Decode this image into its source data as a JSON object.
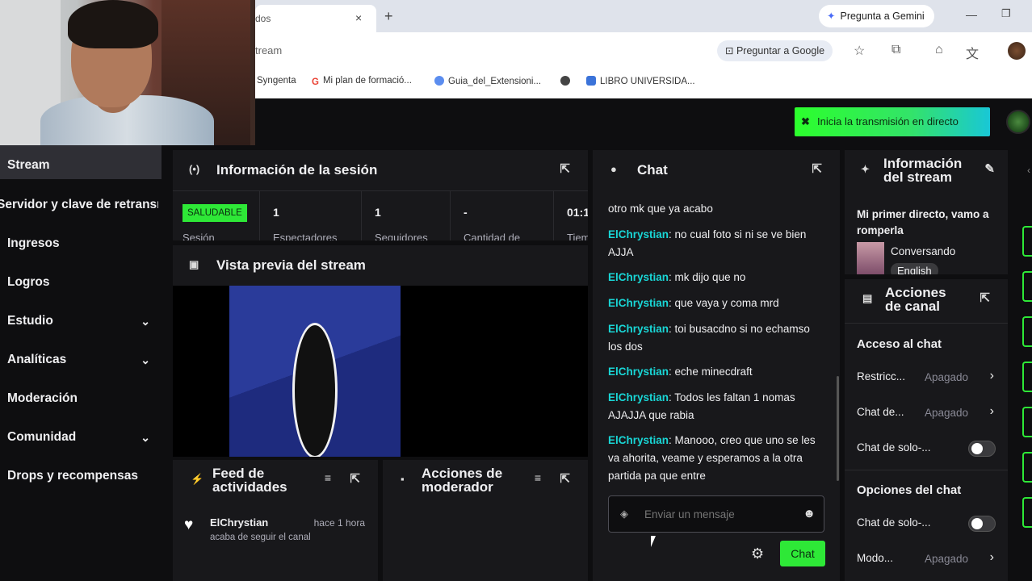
{
  "browser": {
    "tab_title": "dos",
    "tab_close": "×",
    "new_tab": "+",
    "gemini_button": "Pregunta a Gemini",
    "url": "tream",
    "ask_google": "Preguntar a Google",
    "bookmarks": [
      {
        "label": "Syngenta",
        "icon_color": "#1e88e5"
      },
      {
        "label": "Mi plan de formació...",
        "icon_color": "#ea4335"
      },
      {
        "label": "Guia_del_Extensioni...",
        "icon_color": "#5b8def"
      },
      {
        "label": "",
        "icon_color": "#444444"
      },
      {
        "label": "LIBRO UNIVERSIDA...",
        "icon_color": "#3b73d9"
      }
    ]
  },
  "topbar": {
    "go_live": "Inicia la transmisión en directo",
    "accent": "#2ee837"
  },
  "sidebar": {
    "items": [
      {
        "label": "Stream"
      },
      {
        "label": "Servidor y clave de retransmisión"
      },
      {
        "label": "Ingresos"
      },
      {
        "label": "Logros"
      },
      {
        "label": "Estudio",
        "chevron": "⌄"
      },
      {
        "label": "Analíticas",
        "chevron": "⌄"
      },
      {
        "label": "Moderación"
      },
      {
        "label": "Comunidad",
        "chevron": "⌄"
      },
      {
        "label": "Drops y recompensas"
      }
    ]
  },
  "session": {
    "title": "Información de la sesión",
    "badge": "SALUDABLE",
    "badge_sub": "Sesión",
    "stats": [
      {
        "value": "1",
        "label": "Espectadores"
      },
      {
        "value": "1",
        "label": "Seguidores"
      },
      {
        "value": "-",
        "label": "Cantidad de"
      },
      {
        "value": "01:1",
        "label": "Tiem"
      }
    ]
  },
  "preview": {
    "title": "Vista previa del stream"
  },
  "feed": {
    "title_line1": "Feed de",
    "title_line2": "actividades",
    "item": {
      "user": "ElChrystian",
      "time": "hace 1 hora",
      "action": "acaba de seguir el canal"
    }
  },
  "modactions": {
    "title_line1": "Acciones de",
    "title_line2": "moderador"
  },
  "chat": {
    "title": "Chat",
    "messages": [
      {
        "user": "",
        "text": "otro mk que ya acabo"
      },
      {
        "user": "ElChrystian",
        "text": "no cual foto si ni se ve bien AJJA"
      },
      {
        "user": "ElChrystian",
        "text": "mk dijo que no"
      },
      {
        "user": "ElChrystian",
        "text": "que vaya y coma mrd"
      },
      {
        "user": "ElChrystian",
        "text": "toi busacdno si no echamso los dos"
      },
      {
        "user": "ElChrystian",
        "text": "eche minecdraft"
      },
      {
        "user": "ElChrystian",
        "text": "Todos les faltan 1 nomas AJAJJA que rabia"
      },
      {
        "user": "ElChrystian",
        "text": "Manooo, creo que uno se les va ahorita, veame y esperamos a la otra partida pa que entre"
      }
    ],
    "input_placeholder": "Enviar un mensaje",
    "send_label": "Chat"
  },
  "stream_info": {
    "title_line1": "Información",
    "title_line2": "del stream",
    "stream_title": "Mi primer directo, vamo a romperla",
    "category": "Conversando",
    "tag": "English"
  },
  "channel_actions": {
    "title_line1": "Acciones",
    "title_line2": "de canal",
    "chat_access_header": "Acceso al chat",
    "chat_options_header": "Opciones del chat",
    "rows": [
      {
        "key": "Restricc...",
        "value": "Apagado"
      },
      {
        "key": "Chat de...",
        "value": "Apagado"
      },
      {
        "key": "Chat de solo-...",
        "value": ""
      },
      {
        "key": "Chat de solo-...",
        "value": ""
      },
      {
        "key": "Modo...",
        "value": "Apagado"
      }
    ]
  }
}
